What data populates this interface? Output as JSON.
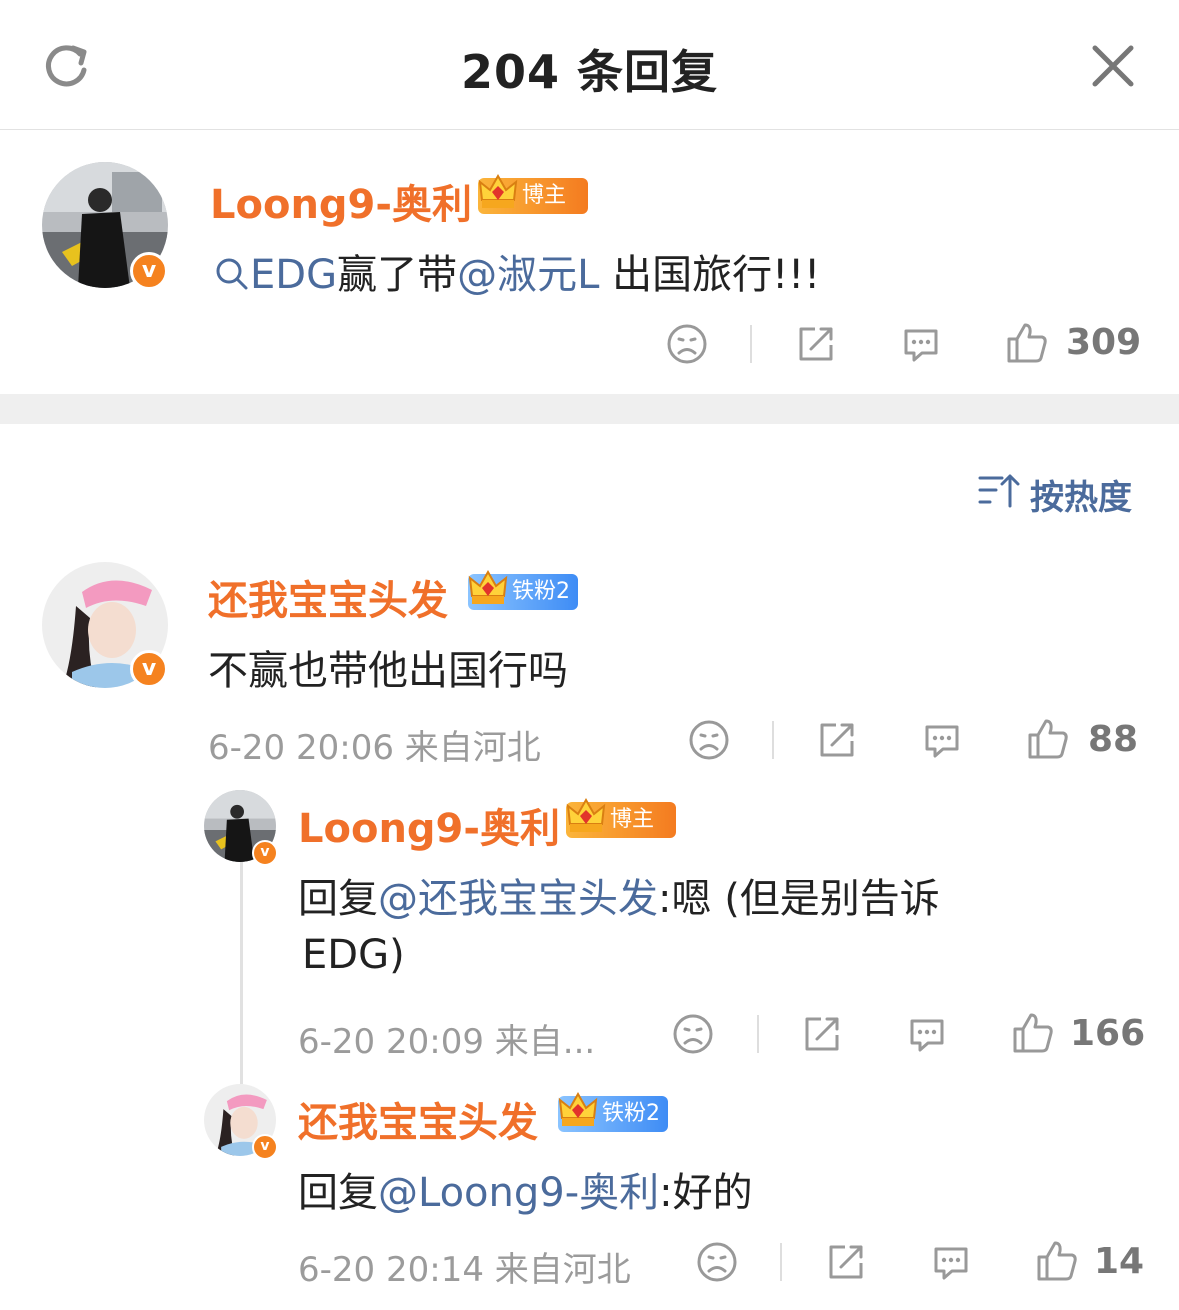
{
  "header": {
    "title": "204 条回复",
    "refresh_icon": "refresh-icon",
    "close_icon": "close-icon"
  },
  "post": {
    "author": "Loong9-奥利",
    "badge": "博主",
    "search_icon": "search-icon",
    "hashtag": "EDG",
    "text_part1": "赢了带",
    "mention": "@淑元L",
    "text_part2": "出国旅行!!!",
    "like_count": "309"
  },
  "sort": {
    "label": "按热度",
    "icon": "sort-icon"
  },
  "comments": [
    {
      "author": "还我宝宝头发",
      "badge": "铁粉2",
      "text": "不赢也带他出国行吗",
      "meta": "6-20 20:06 来自河北",
      "like_count": "88"
    }
  ],
  "replies": [
    {
      "author": "Loong9-奥利",
      "badge": "博主",
      "prefix": "回复",
      "mention": "@还我宝宝头发",
      "text_line1": ":嗯 (但是别告诉",
      "text_line2": "EDG)",
      "meta": "6-20 20:09 来自...",
      "like_count": "166"
    },
    {
      "author": "还我宝宝头发",
      "badge": "铁粉2",
      "prefix": "回复",
      "mention": "@Loong9-奥利",
      "text": ":好的",
      "meta": "6-20 20:14 来自河北",
      "like_count": "14"
    }
  ],
  "colors": {
    "name": "#f0702a",
    "mention": "#4b6b9c",
    "meta": "#9b9b9b",
    "verified": "#f5821f"
  }
}
